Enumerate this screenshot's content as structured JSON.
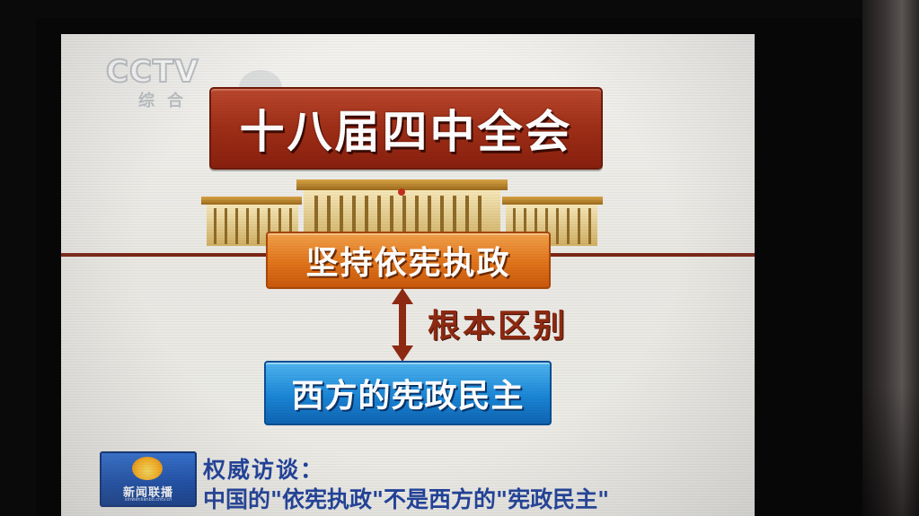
{
  "logo": {
    "brand": "CCTV",
    "channel": "综合"
  },
  "title": "十八届四中全会",
  "top_plate": "坚持依宪执政",
  "relation_label": "根本区别",
  "bottom_plate": "西方的宪政民主",
  "news_program": {
    "name": "新闻联播",
    "domain": "xinwenlianbo.cntv.cn"
  },
  "caption": {
    "line1": "权威访谈：",
    "line2": "中国的\"依宪执政\"不是西方的\"宪政民主\""
  },
  "colors": {
    "title_plate": "#9e2e17",
    "top_plate": "#e0741b",
    "bottom_plate": "#1a86d6",
    "relation_label": "#8e2a12",
    "caption_text": "#1d3f9a"
  }
}
